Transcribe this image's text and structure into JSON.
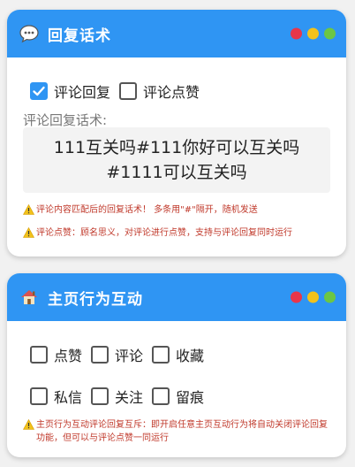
{
  "colors": {
    "header": "#2f95f3",
    "dot_red": "#e8364a",
    "dot_yellow": "#f2c21b",
    "dot_green": "#6cc644",
    "warning": "#c0392b"
  },
  "reply_card": {
    "icon": "speech-bubble-icon",
    "title": "回复话术",
    "options": [
      {
        "label": "评论回复",
        "checked": true
      },
      {
        "label": "评论点赞",
        "checked": false
      }
    ],
    "script_label": "评论回复话术:",
    "script_text": "111互关吗#111你好可以互关吗#1111可以互关吗",
    "notices": [
      "评论内容匹配后的回复话术！ 多条用\"#\"隔开，随机发送",
      "评论点赞：顾名思义，对评论进行点赞，支持与评论回复同时运行"
    ]
  },
  "home_card": {
    "icon": "house-icon",
    "title": "主页行为互动",
    "row1": [
      {
        "label": "点赞",
        "checked": false
      },
      {
        "label": "评论",
        "checked": false
      },
      {
        "label": "收藏",
        "checked": false
      }
    ],
    "row2": [
      {
        "label": "私信",
        "checked": false
      },
      {
        "label": "关注",
        "checked": false
      },
      {
        "label": "留痕",
        "checked": false
      }
    ],
    "notice": "主页行为互动评论回复互斥：即开启任意主页互动行为将自动关闭评论回复功能，但可以与评论点赞一同运行"
  }
}
